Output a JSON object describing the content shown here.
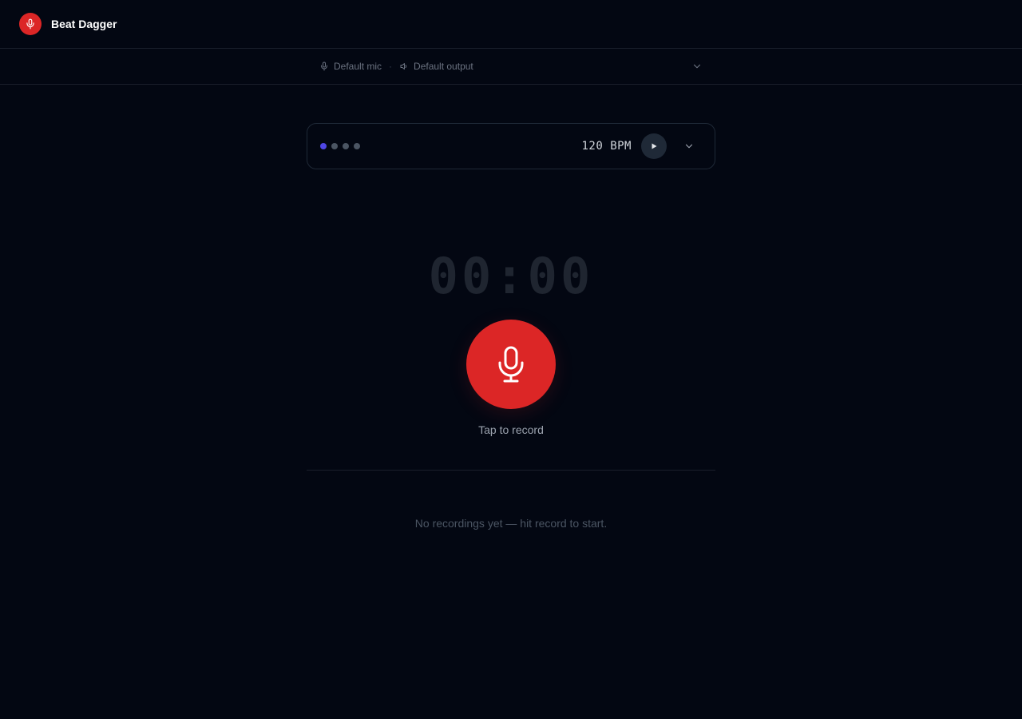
{
  "app": {
    "title": "Beat Dagger",
    "logo_icon": "microphone-icon",
    "accent_color": "#dc2626"
  },
  "devices": {
    "input_icon": "microphone-icon",
    "input_label": "Default mic",
    "separator": "·",
    "output_icon": "speaker-icon",
    "output_label": "Default output"
  },
  "metronome": {
    "beats_total": 4,
    "active_beat": 1,
    "active_color": "#4f46e5",
    "bpm_label": "120 BPM",
    "play_icon": "play-icon",
    "expand_icon": "chevron-down-icon"
  },
  "recorder": {
    "timer": "00:00",
    "record_icon": "microphone-icon",
    "record_label": "Tap to record"
  },
  "recordings": {
    "empty_message": "No recordings yet — hit record to start."
  }
}
